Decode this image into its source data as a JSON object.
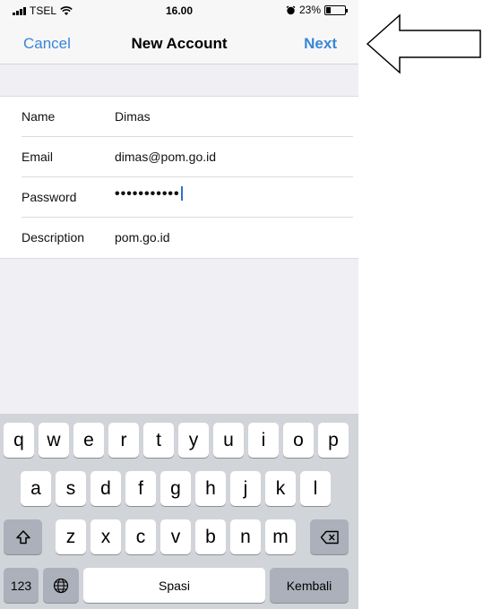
{
  "status_bar": {
    "carrier": "TSEL",
    "time": "16.00",
    "battery_percent": "23%",
    "battery_level": 0.23
  },
  "navbar": {
    "cancel_label": "Cancel",
    "title": "New Account",
    "next_label": "Next",
    "accent_color": "#3a86d6"
  },
  "form": {
    "rows": [
      {
        "label": "Name",
        "value": "Dimas"
      },
      {
        "label": "Email",
        "value": "dimas@pom.go.id"
      },
      {
        "label": "Password",
        "value": "•••••••••••"
      },
      {
        "label": "Description",
        "value": "pom.go.id"
      }
    ]
  },
  "keyboard": {
    "row1": [
      "q",
      "w",
      "e",
      "r",
      "t",
      "y",
      "u",
      "i",
      "o",
      "p"
    ],
    "row2": [
      "a",
      "s",
      "d",
      "f",
      "g",
      "h",
      "j",
      "k",
      "l"
    ],
    "row3": [
      "z",
      "x",
      "c",
      "v",
      "b",
      "n",
      "m"
    ],
    "numbers_label": "123",
    "space_label": "Spasi",
    "return_label": "Kembali",
    "shift_icon": "shift-icon",
    "delete_icon": "delete-icon",
    "globe_icon": "globe-icon"
  },
  "annotation": {
    "arrow_icon": "left-arrow-icon"
  }
}
